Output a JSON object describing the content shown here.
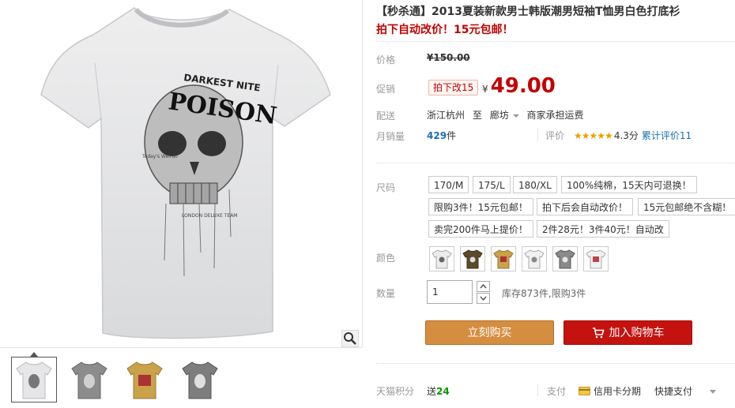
{
  "product": {
    "title": "【秒杀通】2013夏装新款男士韩版潮男短袖T恤男白色打底衫",
    "subtitle": "拍下自动改价！15元包邮！"
  },
  "price": {
    "label": "价格",
    "original": "¥150.00",
    "promo_label": "促销",
    "promo_badge": "拍下改15",
    "promo_yen": "¥",
    "promo_value": "49.00"
  },
  "shipping": {
    "label": "配送",
    "from": "浙江杭州",
    "to_word": "至",
    "dest": "廊坊",
    "note": "商家承担运费"
  },
  "sales": {
    "label": "月销量",
    "count": "429",
    "unit": "件",
    "rating_label": "评价",
    "stars": "★★★★★",
    "score": "4.3分",
    "review_link": "累计评价11"
  },
  "size": {
    "label": "尺码",
    "options": [
      "170/M",
      "175/L",
      "180/XL",
      "100%纯棉，15天内可退换！",
      "限购3件！15元包邮！",
      "拍下后会自动改价！",
      "15元包邮绝不含糊！",
      "卖完200件马上提价！",
      "2件28元！3件40元！自动改"
    ]
  },
  "color": {
    "label": "颜色",
    "swatches": [
      "white-skull",
      "brown-skull",
      "yellow-skull",
      "white-skull-2",
      "gray-skull",
      "white-graphic"
    ]
  },
  "quantity": {
    "label": "数量",
    "value": "1",
    "stock": "库存873件,限购3件"
  },
  "buttons": {
    "buy_now": "立刻购买",
    "add_to_cart": "加入购物车"
  },
  "footer": {
    "points_label": "天猫积分",
    "points_prefix": "送",
    "points_value": "24",
    "pay_label": "支付",
    "credit": "信用卡分期",
    "quick_pay": "快捷支付"
  },
  "colors": {
    "accent_red": "#c40000",
    "buy_orange": "#d58d3f",
    "cart_red": "#c4120e",
    "link_blue": "#1b6eb6"
  },
  "image": {
    "shirt_print": "DARKEST NITE POISON",
    "zoom_icon": "magnifier-icon"
  }
}
